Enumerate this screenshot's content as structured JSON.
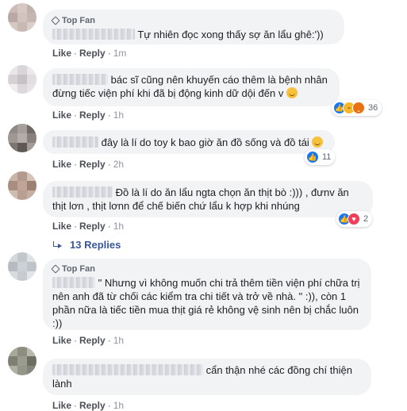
{
  "comments": [
    {
      "top_fan": "Top Fan",
      "text": "Tự nhiên đọc xong thấy sợ ăn lẩu ghê:'))",
      "like": "Like",
      "reply": "Reply",
      "time": "1m"
    },
    {
      "text": "bác sĩ cũng nên khuyến cáo thêm là bệnh nhân đừng tiếc viện phí khi đã bị động kinh dữ dội đến v",
      "like": "Like",
      "reply": "Reply",
      "time": "1h",
      "reactions": {
        "icons": [
          "like-icon",
          "haha-icon",
          "angry-icon"
        ],
        "count": "36"
      }
    },
    {
      "text": "đây là lí do toy k bao giờ ăn đồ sống và đồ tái",
      "like": "Like",
      "reply": "Reply",
      "time": "2h",
      "reactions": {
        "icons": [
          "like-icon"
        ],
        "count": "11"
      }
    },
    {
      "text": "Đồ là lí do ăn lẩu ngta chọn ăn thịt bò :))) , đưnv ăn thịt lơn , thịt lơnn để chế biến chứ lẩu k hợp khi nhúng",
      "like": "Like",
      "reply": "Reply",
      "time": "1h",
      "reactions": {
        "icons": [
          "like-icon",
          "love-icon"
        ],
        "count": "2"
      },
      "replies_label": "13 Replies"
    },
    {
      "top_fan": "Top Fan",
      "text": "\" Nhưng vì không muốn chi trả thêm tiền viện phí chữa trị nên anh đã từ chối các kiểm tra chi tiết và trở về nhà. \" :)), còn 1 phần nữa là tiếc tiền mua thịt giá rẻ không vệ sinh nên bị chắc luôn :))",
      "like": "Like",
      "reply": "Reply",
      "time": "1h"
    },
    {
      "text": "cẩn thận nhé các đồng chí thiện lành",
      "like": "Like",
      "reply": "Reply",
      "time": "1h"
    }
  ],
  "colors": {
    "bubble": "#f2f3f5",
    "link": "#385898",
    "like_blue": "#1877f2"
  }
}
